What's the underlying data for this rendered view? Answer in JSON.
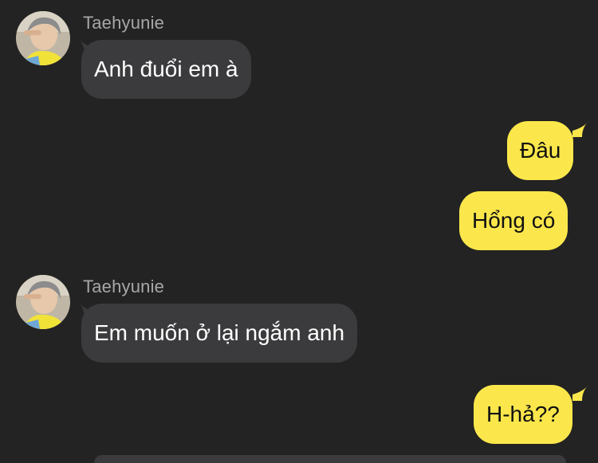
{
  "colors": {
    "background": "#232323",
    "incoming_bubble": "#3b3b3d",
    "outgoing_bubble": "#fbe74b",
    "sender_name": "#a7a7a7"
  },
  "messages": [
    {
      "direction": "incoming",
      "sender": "Taehyunie",
      "text": "Anh đuổi em à",
      "avatar_icon": "profile-photo"
    },
    {
      "direction": "outgoing",
      "text": "Đâu"
    },
    {
      "direction": "outgoing",
      "text": "Hổng có"
    },
    {
      "direction": "incoming",
      "sender": "Taehyunie",
      "text": "Em muốn ở lại ngắm anh",
      "avatar_icon": "profile-photo"
    },
    {
      "direction": "outgoing",
      "text": "H-hả??"
    }
  ]
}
